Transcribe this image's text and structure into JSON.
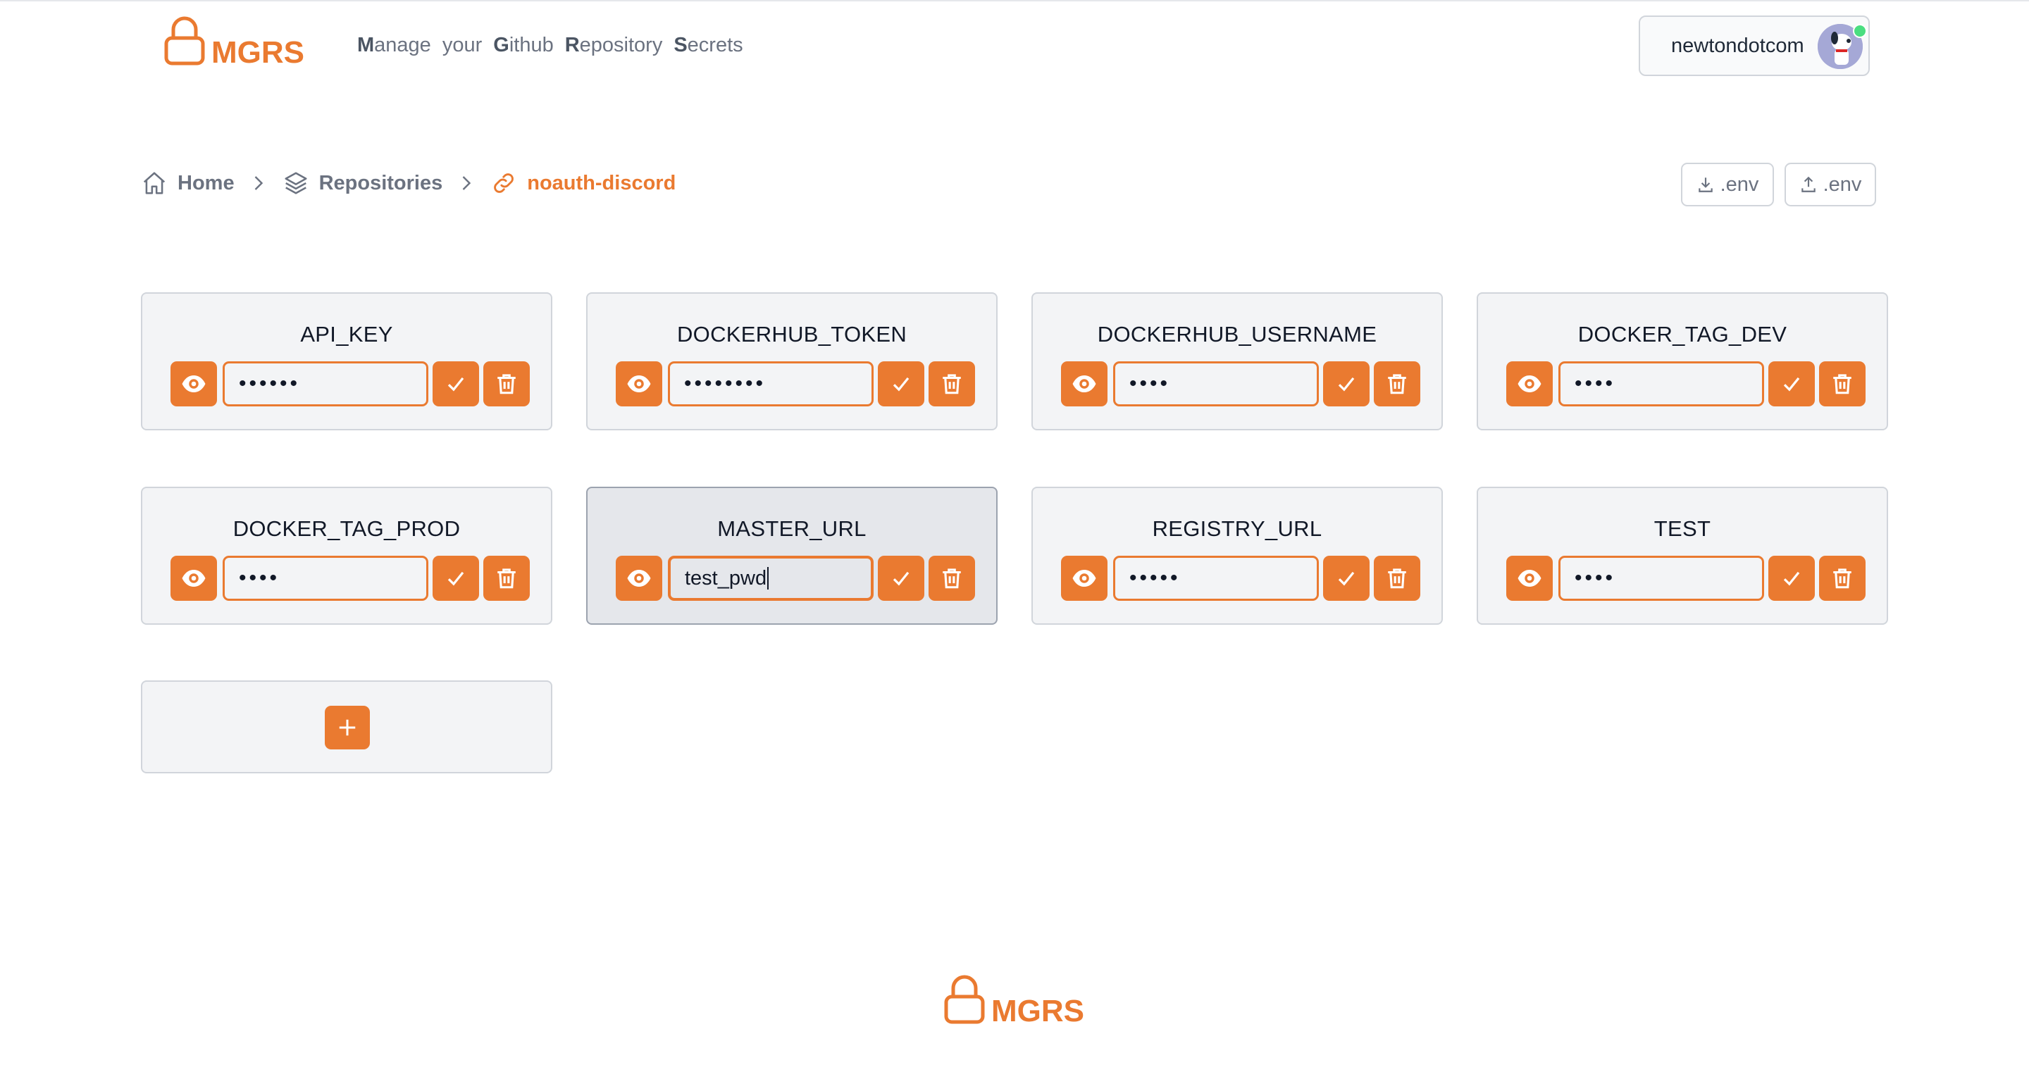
{
  "brand": {
    "name": "MGRS",
    "accent": "#ea7a30"
  },
  "tagline": [
    {
      "first": "M",
      "rest": "anage"
    },
    {
      "first": "",
      "rest": "your"
    },
    {
      "first": "G",
      "rest": "ithub"
    },
    {
      "first": "R",
      "rest": "epository"
    },
    {
      "first": "S",
      "rest": "ecrets"
    }
  ],
  "user": {
    "name": "newtondotcom"
  },
  "breadcrumb": {
    "home": "Home",
    "repositories": "Repositories",
    "current": "noauth-discord"
  },
  "actions": {
    "download_env": ".env",
    "upload_env": ".env"
  },
  "secrets": [
    {
      "name": "API_KEY",
      "value": "••••••"
    },
    {
      "name": "DOCKERHUB_TOKEN",
      "value": "••••••••"
    },
    {
      "name": "DOCKERHUB_USERNAME",
      "value": "••••"
    },
    {
      "name": "DOCKER_TAG_DEV",
      "value": "••••"
    },
    {
      "name": "DOCKER_TAG_PROD",
      "value": "••••"
    },
    {
      "name": "MASTER_URL",
      "value": "test_pwd"
    },
    {
      "name": "REGISTRY_URL",
      "value": "•••••"
    },
    {
      "name": "TEST",
      "value": "••••"
    }
  ],
  "icons": {
    "eye": "eye-icon",
    "save": "check-icon",
    "delete": "trash-icon",
    "add": "plus-icon",
    "home": "home-icon",
    "repositories": "layers-icon",
    "current": "link-icon",
    "download": "download-icon",
    "upload": "upload-icon"
  }
}
